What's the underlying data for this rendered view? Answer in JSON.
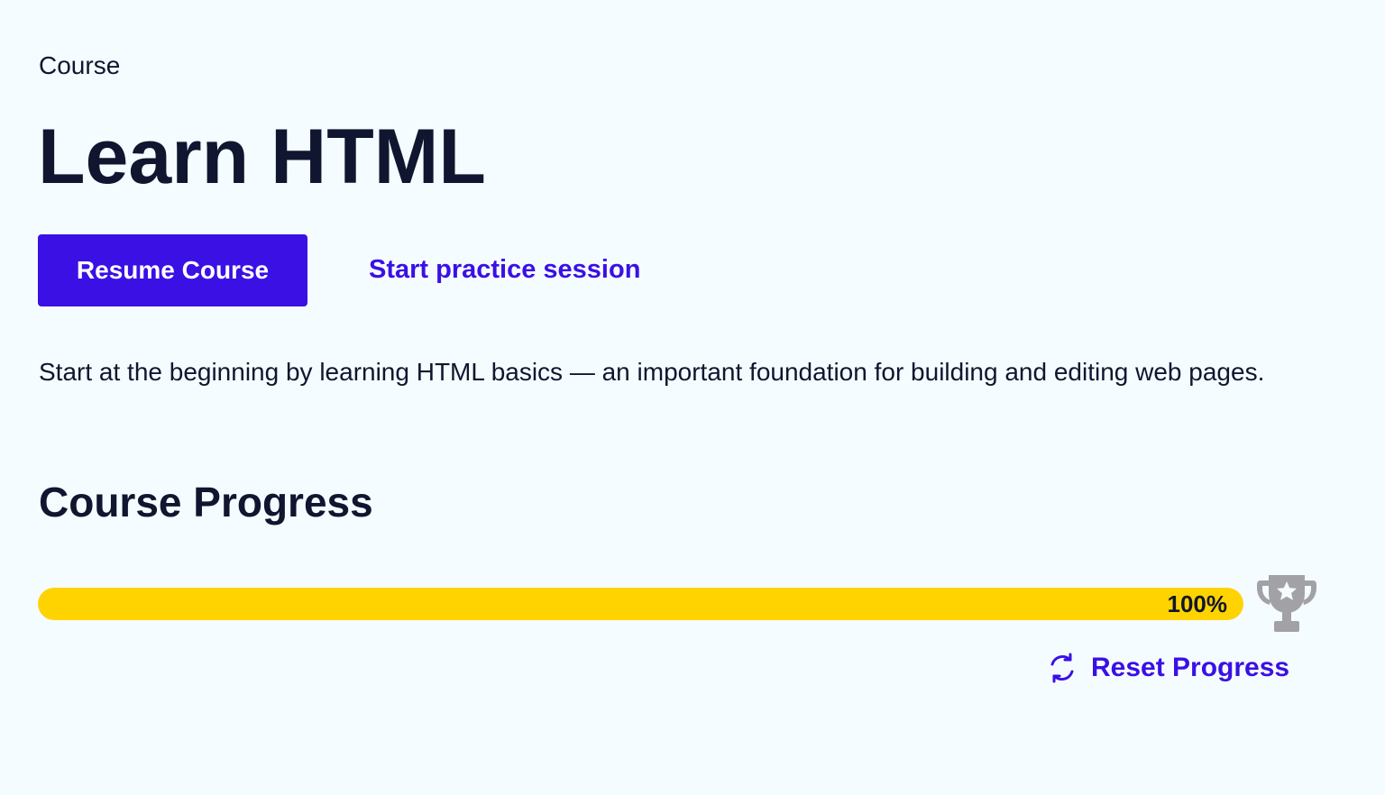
{
  "header": {
    "eyebrow": "Course",
    "title": "Learn HTML"
  },
  "actions": {
    "resume_label": "Resume Course",
    "practice_label": "Start practice session"
  },
  "description": "Start at the beginning by learning HTML basics — an important foundation for building and editing web pages.",
  "progress": {
    "section_title": "Course Progress",
    "percent": 100,
    "percent_label": "100%",
    "reset_label": "Reset Progress",
    "fill_color": "#ffd300",
    "trophy_icon": "trophy-icon",
    "reset_icon": "refresh-icon"
  },
  "colors": {
    "accent": "#3a10e5",
    "text": "#10162f",
    "background": "#f5fcff",
    "progress": "#ffd300",
    "trophy": "#a2a2a6"
  }
}
